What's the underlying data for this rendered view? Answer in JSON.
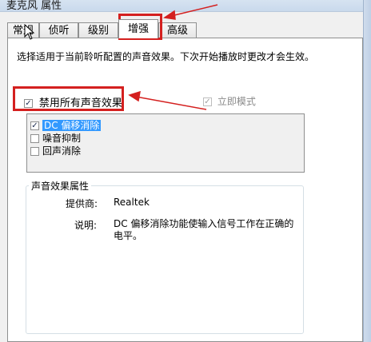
{
  "window": {
    "title": "麦克风 属性"
  },
  "tabs": [
    {
      "label": "常规"
    },
    {
      "label": "侦听"
    },
    {
      "label": "级别"
    },
    {
      "label": "增强"
    },
    {
      "label": "高级"
    }
  ],
  "enhancements": {
    "description": "选择适用于当前聆听配置的声音效果。下次开始播放时更改才会生效。",
    "disable_all_label": "禁用所有声音效果",
    "disable_all_checked": true,
    "immediate_mode_label": "立即模式",
    "immediate_mode_checked": true,
    "effects": [
      {
        "label": "DC 偏移消除",
        "checked": true,
        "selected": true
      },
      {
        "label": "噪音抑制",
        "checked": false
      },
      {
        "label": "回声消除",
        "checked": false
      }
    ]
  },
  "properties": {
    "group_title": "声音效果属性",
    "provider_label": "提供商:",
    "provider_value": "Realtek",
    "description_label": "说明:",
    "description_value": "DC 偏移消除功能使输入信号工作在正确的电平。"
  },
  "colors": {
    "annotation_red": "#d4201f",
    "selection_blue": "#3399ff"
  }
}
